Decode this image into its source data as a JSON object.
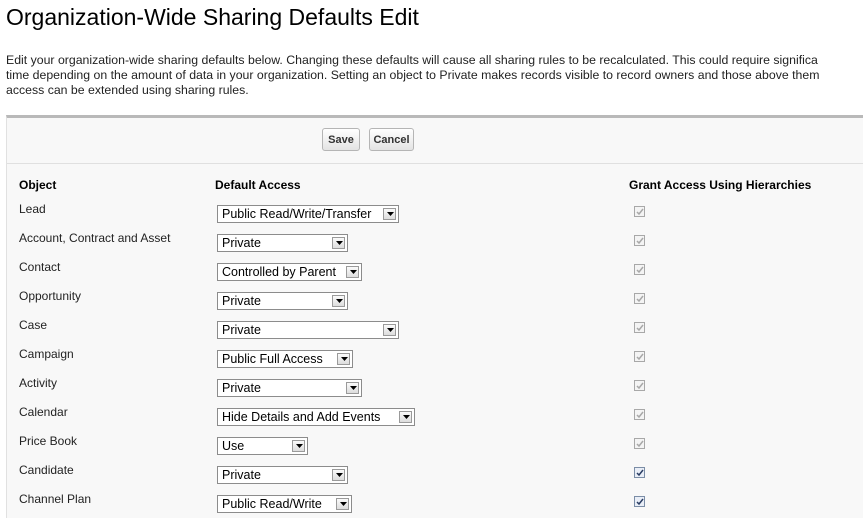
{
  "page": {
    "title": "Organization-Wide Sharing Defaults Edit",
    "description": [
      "Edit your organization-wide sharing defaults below. Changing these defaults will cause all sharing rules to be recalculated. This could require significa",
      "time depending on the amount of data in your organization. Setting an object to Private makes records visible to record owners and those above them",
      "access can be extended using sharing rules."
    ]
  },
  "toolbar": {
    "save_label": "Save",
    "cancel_label": "Cancel"
  },
  "columns": {
    "object": "Object",
    "default_access": "Default Access",
    "grant_access": "Grant Access Using Hierarchies"
  },
  "rows": [
    {
      "object": "Lead",
      "access": "Public Read/Write/Transfer",
      "grant_checked": true,
      "grant_enabled": false
    },
    {
      "object": "Account, Contract and Asset",
      "access": "Private",
      "grant_checked": true,
      "grant_enabled": false
    },
    {
      "object": "Contact",
      "access": "Controlled by Parent",
      "grant_checked": true,
      "grant_enabled": false
    },
    {
      "object": "Opportunity",
      "access": "Private",
      "grant_checked": true,
      "grant_enabled": false
    },
    {
      "object": "Case",
      "access": "Private",
      "grant_checked": true,
      "grant_enabled": false
    },
    {
      "object": "Campaign",
      "access": "Public Full Access",
      "grant_checked": true,
      "grant_enabled": false
    },
    {
      "object": "Activity",
      "access": "Private",
      "grant_checked": true,
      "grant_enabled": false
    },
    {
      "object": "Calendar",
      "access": "Hide Details and Add Events",
      "grant_checked": true,
      "grant_enabled": false
    },
    {
      "object": "Price Book",
      "access": "Use",
      "grant_checked": true,
      "grant_enabled": false
    },
    {
      "object": "Candidate",
      "access": "Private",
      "grant_checked": true,
      "grant_enabled": true
    },
    {
      "object": "Channel Plan",
      "access": "Public Read/Write",
      "grant_checked": true,
      "grant_enabled": true
    }
  ],
  "icons": {
    "dropdown_arrow": "chevron-down-icon",
    "checkmark": "checkmark-icon"
  },
  "colors": {
    "panel_background": "#f8f8f8",
    "panel_top_border": "#b9b9b9",
    "button_border": "#b5b5b5",
    "disabled_check": "#a8a8a8",
    "enabled_check": "#2a3d63"
  }
}
